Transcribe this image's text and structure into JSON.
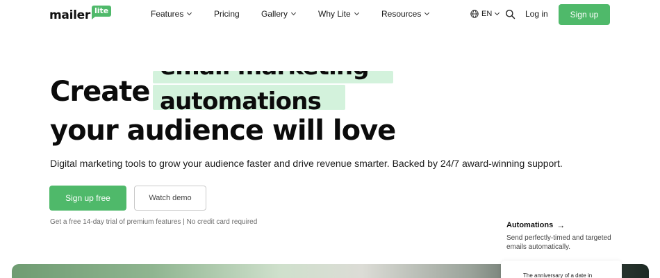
{
  "nav": {
    "logo_text": "mailer",
    "logo_badge": "lite",
    "menu": [
      {
        "label": "Features",
        "dropdown": true
      },
      {
        "label": "Pricing",
        "dropdown": false
      },
      {
        "label": "Gallery",
        "dropdown": true
      },
      {
        "label": "Why Lite",
        "dropdown": true
      },
      {
        "label": "Resources",
        "dropdown": true
      }
    ],
    "language": "EN",
    "login_label": "Log in",
    "signup_label": "Sign up"
  },
  "hero": {
    "title_word": "Create",
    "rotating_line_1": "email marketing",
    "rotating_line_2": "automations",
    "title_tail": "your audience will love",
    "subtitle": "Digital marketing tools to grow your audience faster and drive revenue smarter. Backed by 24/7 award-winning support.",
    "primary_cta": "Sign up free",
    "secondary_cta": "Watch demo",
    "trial_note": "Get a free 14-day trial of premium features | No credit card required"
  },
  "feature": {
    "title": "Automations",
    "arrow": "→",
    "description": "Send perfectly-timed and targeted emails automatically."
  },
  "preview_card": {
    "text": "The anniversary of a date in"
  },
  "colors": {
    "brand_green": "#4fb96a",
    "highlight_green": "#d3f2dc",
    "text_dark": "#0b0b0b"
  },
  "icons": {
    "language": "globe-icon",
    "search": "search-icon",
    "dropdown": "chevron-down-icon",
    "feature_link": "arrow-right-icon"
  }
}
